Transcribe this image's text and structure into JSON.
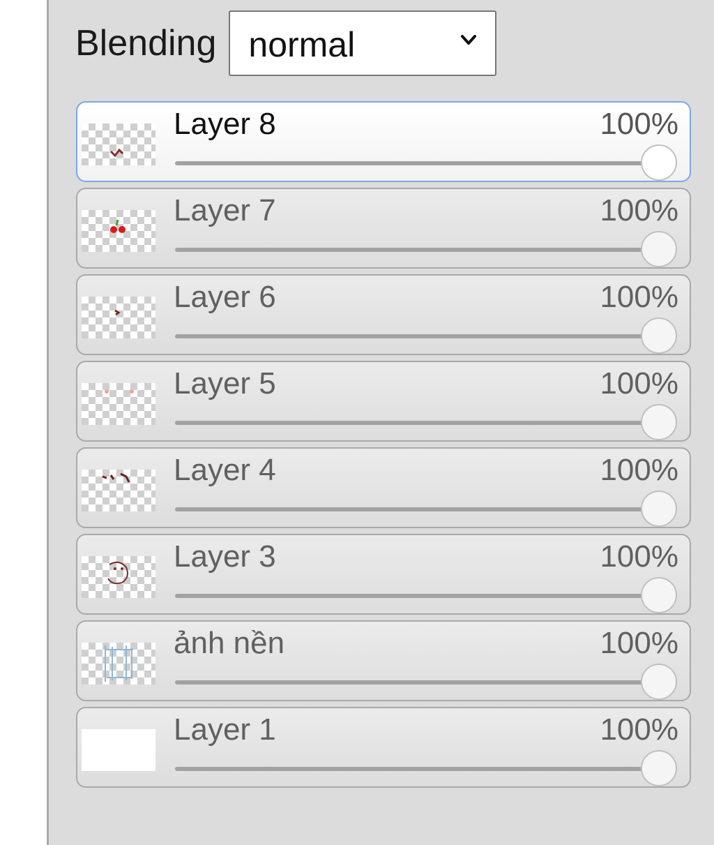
{
  "blending": {
    "label": "Blending",
    "value": "normal"
  },
  "layers": [
    {
      "name": "Layer 8",
      "opacity_label": "100%",
      "opacity": 1.0,
      "selected": true,
      "thumb": "small-dark-mark"
    },
    {
      "name": "Layer 7",
      "opacity_label": "100%",
      "opacity": 1.0,
      "selected": false,
      "thumb": "red-cherries"
    },
    {
      "name": "Layer 6",
      "opacity_label": "100%",
      "opacity": 1.0,
      "selected": false,
      "thumb": "tiny-mark"
    },
    {
      "name": "Layer 5",
      "opacity_label": "100%",
      "opacity": 1.0,
      "selected": false,
      "thumb": "pink-dots"
    },
    {
      "name": "Layer 4",
      "opacity_label": "100%",
      "opacity": 1.0,
      "selected": false,
      "thumb": "dark-strokes"
    },
    {
      "name": "Layer 3",
      "opacity_label": "100%",
      "opacity": 1.0,
      "selected": false,
      "thumb": "outline-sketch"
    },
    {
      "name": "ảnh nền",
      "opacity_label": "100%",
      "opacity": 1.0,
      "selected": false,
      "thumb": "blue-sketch"
    },
    {
      "name": "Layer 1",
      "opacity_label": "100%",
      "opacity": 1.0,
      "selected": false,
      "thumb": "white-fill"
    }
  ],
  "colors": {
    "selected_border": "#7aa7f0",
    "panel_bg": "#dcdcdc"
  }
}
